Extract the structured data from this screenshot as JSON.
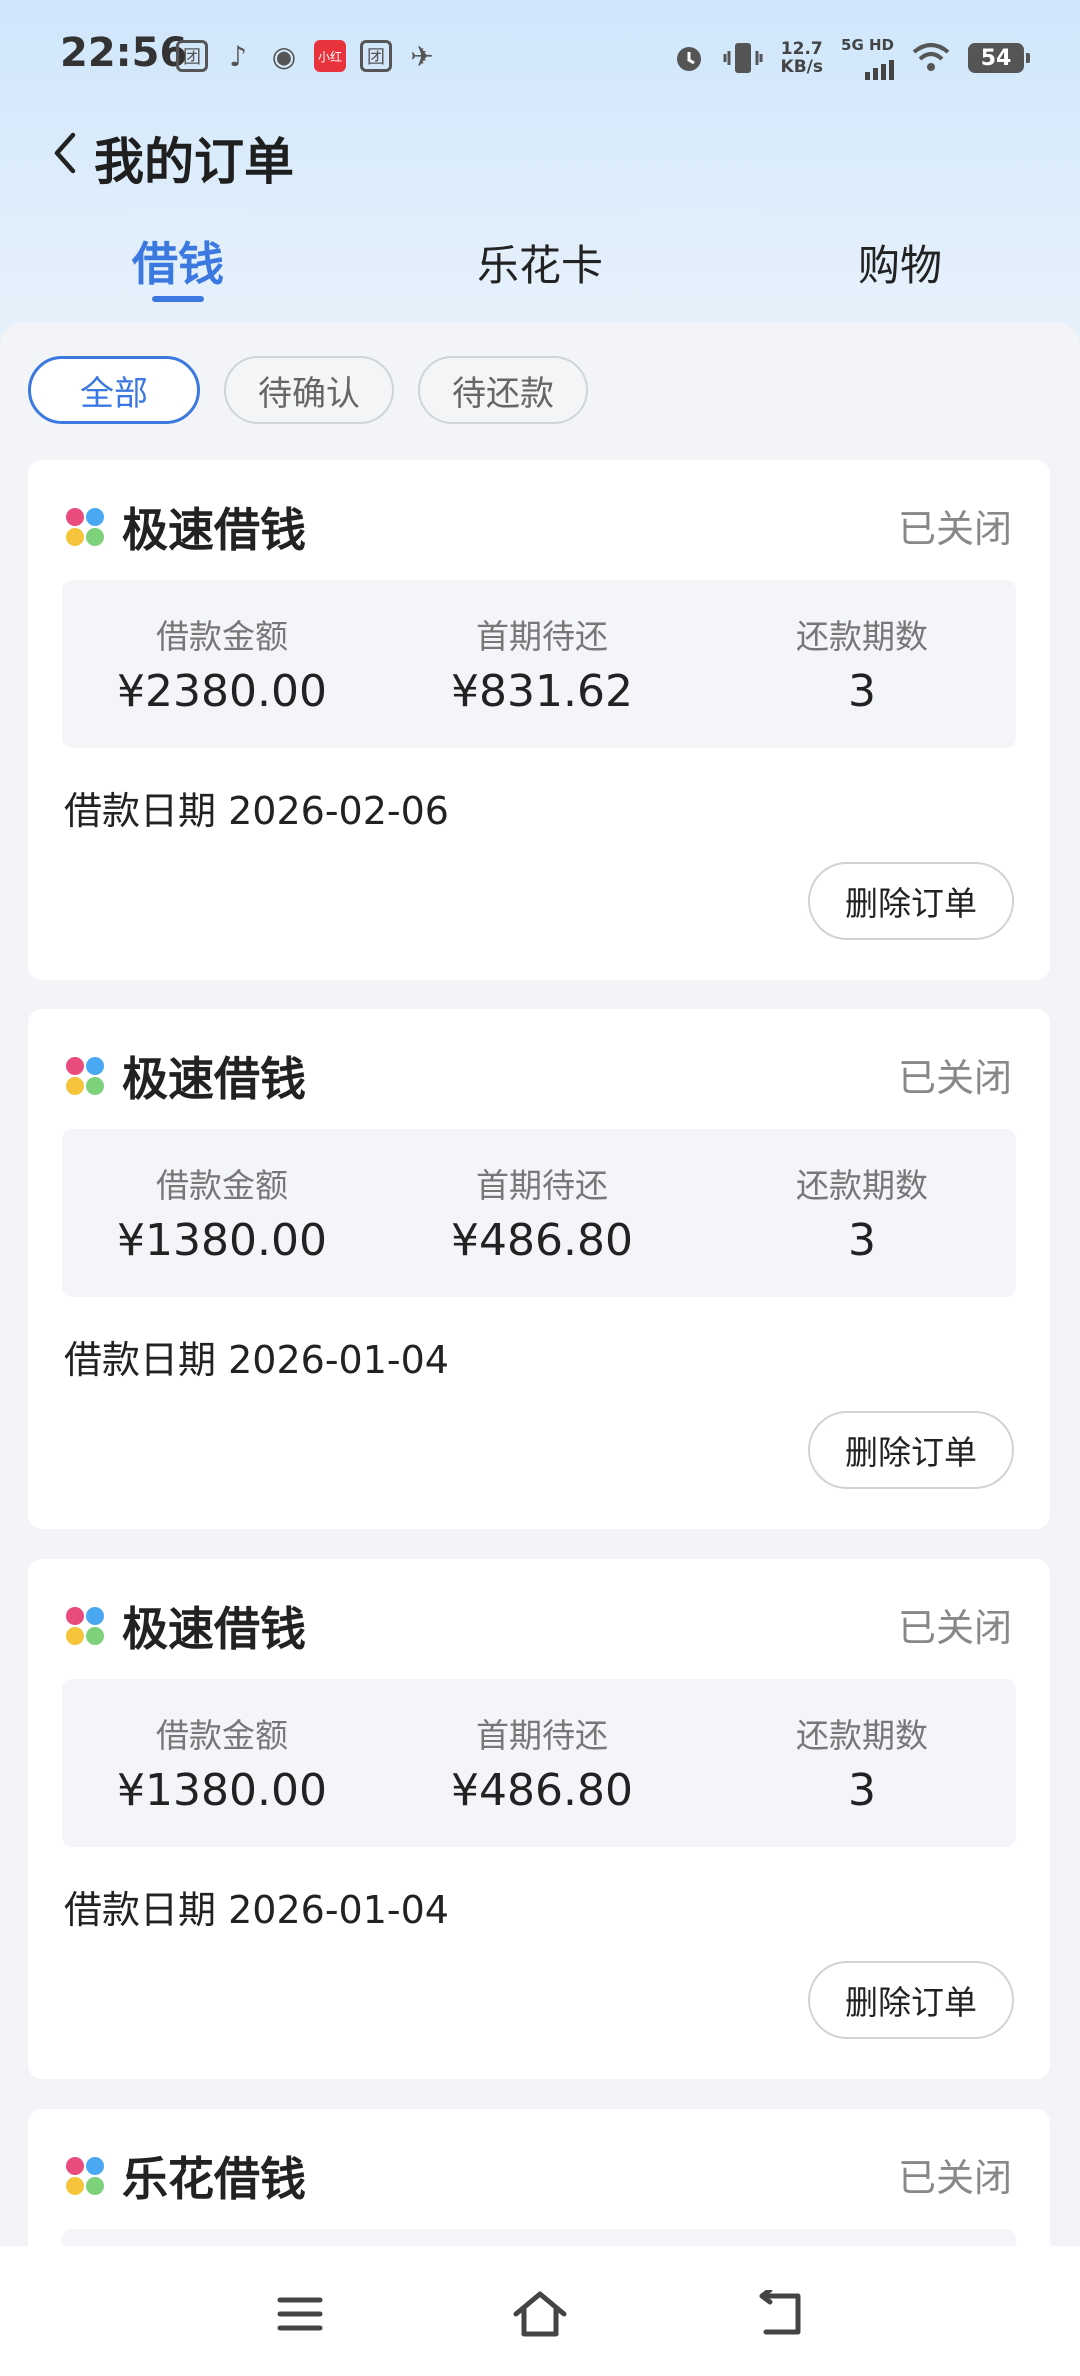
{
  "status_bar": {
    "time": "22:56",
    "net_speed_value": "12.7",
    "net_speed_unit": "KB/s",
    "network": "5G HD",
    "battery": "54"
  },
  "header": {
    "title": "我的订单"
  },
  "tabs": [
    {
      "label": "借钱",
      "active": true
    },
    {
      "label": "乐花卡",
      "active": false
    },
    {
      "label": "购物",
      "active": false
    }
  ],
  "filters": [
    {
      "label": "全部",
      "active": true
    },
    {
      "label": "待确认",
      "active": false
    },
    {
      "label": "待还款",
      "active": false
    }
  ],
  "labels": {
    "amount": "借款金额",
    "first_due": "首期待还",
    "terms": "还款期数",
    "date_prefix": "借款日期",
    "delete": "删除订单"
  },
  "orders": [
    {
      "title": "极速借钱",
      "status": "已关闭",
      "amount": "¥2380.00",
      "first_due": "¥831.62",
      "terms": "3",
      "date": "2026-02-06"
    },
    {
      "title": "极速借钱",
      "status": "已关闭",
      "amount": "¥1380.00",
      "first_due": "¥486.80",
      "terms": "3",
      "date": "2026-01-04"
    },
    {
      "title": "极速借钱",
      "status": "已关闭",
      "amount": "¥1380.00",
      "first_due": "¥486.80",
      "terms": "3",
      "date": "2026-01-04"
    },
    {
      "title": "乐花借钱",
      "status": "已关闭"
    }
  ],
  "icons": {
    "back": "chevron-left-icon",
    "logo_colors": [
      "#e94b7c",
      "#4aa7f2",
      "#f5c43b",
      "#7dd17a"
    ],
    "nav": [
      "menu-icon",
      "home-icon",
      "back-icon"
    ]
  },
  "accent_color": "#3b78e0"
}
